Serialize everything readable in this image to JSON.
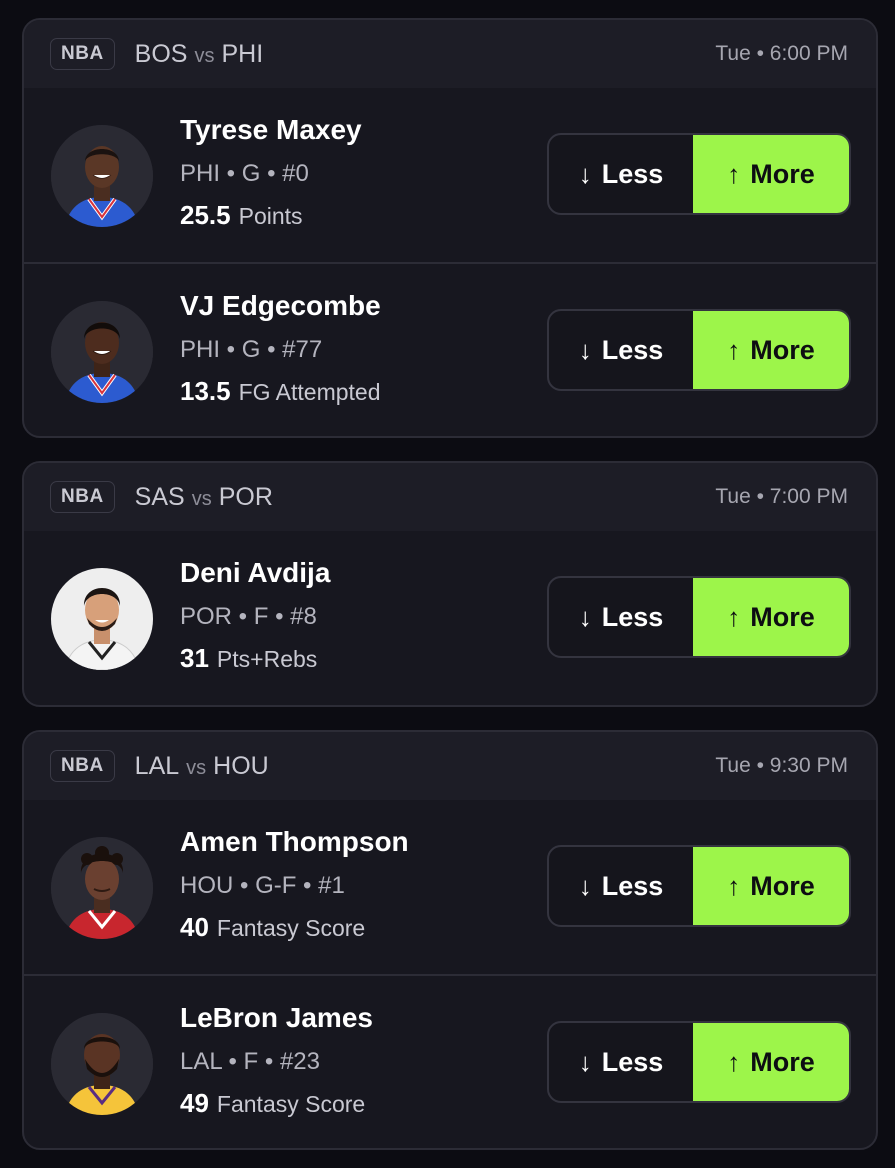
{
  "buttons": {
    "less": "Less",
    "more": "More"
  },
  "icons": {
    "less": "arrow-down-icon",
    "more": "arrow-up-icon"
  },
  "colors": {
    "accent": "#9df54a",
    "background": "#0c0c12",
    "card": "#17171f"
  },
  "games": [
    {
      "league": "NBA",
      "home": "BOS",
      "vs": "vs",
      "away": "PHI",
      "time": "Tue • 6:00 PM",
      "players": [
        {
          "name": "Tyrese Maxey",
          "meta": "PHI • G • #0",
          "value": "25.5",
          "stat": "Points"
        },
        {
          "name": "VJ Edgecombe",
          "meta": "PHI • G • #77",
          "value": "13.5",
          "stat": "FG Attempted"
        }
      ]
    },
    {
      "league": "NBA",
      "home": "SAS",
      "vs": "vs",
      "away": "POR",
      "time": "Tue • 7:00 PM",
      "players": [
        {
          "name": "Deni Avdija",
          "meta": "POR • F • #8",
          "value": "31",
          "stat": "Pts+Rebs"
        }
      ]
    },
    {
      "league": "NBA",
      "home": "LAL",
      "vs": "vs",
      "away": "HOU",
      "time": "Tue • 9:30 PM",
      "players": [
        {
          "name": "Amen Thompson",
          "meta": "HOU • G-F • #1",
          "value": "40",
          "stat": "Fantasy Score"
        },
        {
          "name": "LeBron James",
          "meta": "LAL • F • #23",
          "value": "49",
          "stat": "Fantasy Score"
        }
      ]
    }
  ]
}
